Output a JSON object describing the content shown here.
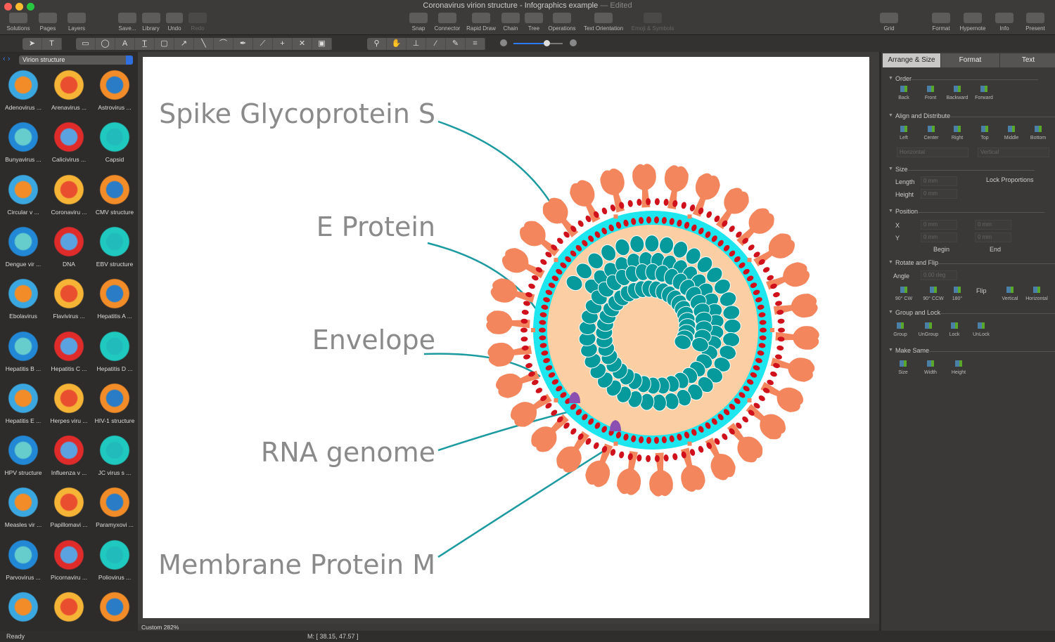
{
  "window": {
    "title": "Coronavirus virion structure - Infographics example",
    "edited": "— Edited"
  },
  "toolbar": {
    "left": [
      "Solutions",
      "Pages",
      "Layers"
    ],
    "file": [
      "Save...",
      "Library",
      "Undo",
      "Redo"
    ],
    "middle": [
      "Snap",
      "Connector",
      "Rapid Draw",
      "Chain",
      "Tree",
      "Operations",
      "Text Orientation",
      "Emoji & Symbols"
    ],
    "grid": "Grid",
    "right": [
      "Format",
      "Hypernote",
      "Info",
      "Present"
    ]
  },
  "library": {
    "selected": "Virion structure",
    "items": [
      "Adenovirus ...",
      "Arenavirus ...",
      "Astrovirus ...",
      "Bunyavirus ...",
      "Calicivirus ...",
      "Capsid",
      "Circular v ...",
      "Coronaviru ...",
      "CMV structure",
      "Dengue vir ...",
      "DNA",
      "EBV structure",
      "Ebolavirus",
      "Flavivirus ...",
      "Hepatitis A ...",
      "Hepatitis B ...",
      "Hepatitis C ...",
      "Hepatitis D ...",
      "Hepatitis E ...",
      "Herpes viru ...",
      "HIV-1 structure",
      "HPV structure",
      "Influenza v ...",
      "JC virus s ...",
      "Measles vir ...",
      "Papillomavi ...",
      "Paramyxovi ...",
      "Parvovirus ...",
      "Picornaviru ...",
      "Poliovirus ...",
      "",
      "",
      ""
    ]
  },
  "diagram": {
    "labels": [
      "Spike Glycoprotein S",
      "E Protein",
      "Envelope",
      "RNA genome",
      "Membrane Protein M"
    ],
    "colors": {
      "spike": "#f4865e",
      "membrane_red": "#d0111b",
      "membrane_cyan": "#1ee6ee",
      "interior": "#fbcfa3",
      "rna": "#079a9c",
      "mprotein": "#8a4fb0",
      "leader": "#1b9aa0"
    }
  },
  "panel": {
    "tabs": [
      "Arrange & Size",
      "Format",
      "Text"
    ],
    "order": {
      "title": "Order",
      "buttons": [
        "Back",
        "Front",
        "Backward",
        "Forward"
      ]
    },
    "align": {
      "title": "Align and Distribute",
      "buttons": [
        "Left",
        "Center",
        "Right",
        "Top",
        "Middle",
        "Bottom"
      ],
      "horizontal": "Horizontal",
      "vertical": "Vertical"
    },
    "size": {
      "title": "Size",
      "length_label": "Length",
      "length": "0 mm",
      "height_label": "Height",
      "height": "0 mm",
      "lock": "Lock Proportions"
    },
    "position": {
      "title": "Position",
      "x_label": "X",
      "y_label": "Y",
      "x_begin": "0 mm",
      "x_end": "0 mm",
      "y_begin": "0 mm",
      "y_end": "0 mm",
      "begin": "Begin",
      "end": "End"
    },
    "rotate": {
      "title": "Rotate and Flip",
      "angle_label": "Angle",
      "angle": "0.00 deg",
      "buttons": [
        "90° CW",
        "90° CCW",
        "180°"
      ],
      "flip": "Flip",
      "flip_buttons": [
        "Vertical",
        "Horizontal"
      ]
    },
    "group": {
      "title": "Group and Lock",
      "buttons": [
        "Group",
        "UnGroup",
        "Lock",
        "UnLock"
      ]
    },
    "same": {
      "title": "Make Same",
      "buttons": [
        "Size",
        "Width",
        "Height"
      ]
    }
  },
  "status": {
    "zoom": "Custom 282%",
    "ready": "Ready",
    "mouse": "M: [ 38.15, 47.57 ]"
  }
}
